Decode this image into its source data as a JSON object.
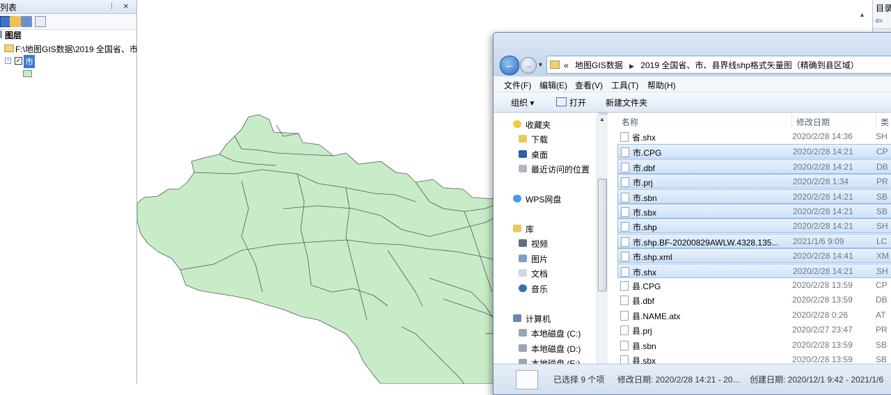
{
  "toc": {
    "title": "列表",
    "layers_root": "图层",
    "data_frame_path": "F:\\地图GIS数据\\2019 全国省、市",
    "layer_name": "市",
    "fill_color": "#c8ecc8"
  },
  "catalog": {
    "title": "目录"
  },
  "explorer": {
    "address": {
      "chevron": "«",
      "part1": "地图GIS数据",
      "part2": "2019 全国省、市、县界线shp格式矢量图（精确到县区域）"
    },
    "menu": [
      "文件(F)",
      "编辑(E)",
      "查看(V)",
      "工具(T)",
      "帮助(H)"
    ],
    "commands": {
      "organize": "组织 ▾",
      "open": "打开",
      "new_folder": "新建文件夹"
    },
    "nav": {
      "favorites": "收藏夹",
      "downloads": "下载",
      "desktop": "桌面",
      "recent": "最近访问的位置",
      "wps": "WPS网盘",
      "library": "库",
      "videos": "视频",
      "pictures": "图片",
      "documents": "文档",
      "music": "音乐",
      "computer": "计算机",
      "disk_c": "本地磁盘 (C:)",
      "disk_d": "本地磁盘 (D:)",
      "disk_e": "本地磁盘 (E:)"
    },
    "columns": {
      "name": "名称",
      "modified": "修改日期",
      "type": "类"
    },
    "files": [
      {
        "name": "省.shx",
        "date": "2020/2/28 14:36",
        "type": "SH",
        "selected": false
      },
      {
        "name": "市.CPG",
        "date": "2020/2/28 14:21",
        "type": "CP",
        "selected": true
      },
      {
        "name": "市.dbf",
        "date": "2020/2/28 14:21",
        "type": "DB",
        "selected": true
      },
      {
        "name": "市.prj",
        "date": "2020/2/28 1:34",
        "type": "PR",
        "selected": true
      },
      {
        "name": "市.sbn",
        "date": "2020/2/28 14:21",
        "type": "SB",
        "selected": true
      },
      {
        "name": "市.sbx",
        "date": "2020/2/28 14:21",
        "type": "SB",
        "selected": true
      },
      {
        "name": "市.shp",
        "date": "2020/2/28 14:21",
        "type": "SH",
        "selected": true
      },
      {
        "name": "市.shp.BF-20200829AWLW.4328.135...",
        "date": "2021/1/6 9:09",
        "type": "LC",
        "selected": true
      },
      {
        "name": "市.shp.xml",
        "date": "2020/2/28 14:41",
        "type": "XM",
        "selected": true
      },
      {
        "name": "市.shx",
        "date": "2020/2/28 14:21",
        "type": "SH",
        "selected": true
      },
      {
        "name": "县.CPG",
        "date": "2020/2/28 13:59",
        "type": "CP",
        "selected": false
      },
      {
        "name": "县.dbf",
        "date": "2020/2/28 13:59",
        "type": "DB",
        "selected": false
      },
      {
        "name": "县.NAME.atx",
        "date": "2020/2/28 0:26",
        "type": "AT",
        "selected": false
      },
      {
        "name": "县.prj",
        "date": "2020/2/27 23:47",
        "type": "PR",
        "selected": false
      },
      {
        "name": "县.sbn",
        "date": "2020/2/28 13:59",
        "type": "SB",
        "selected": false
      },
      {
        "name": "县.sbx",
        "date": "2020/2/28 13:59",
        "type": "SB",
        "selected": false
      }
    ],
    "status": {
      "selected": "已选择 9 个项",
      "modified": "修改日期: 2020/2/28 14:21 - 20...",
      "created": "创建日期: 2020/12/1 9:42 - 2021/1/6"
    }
  }
}
